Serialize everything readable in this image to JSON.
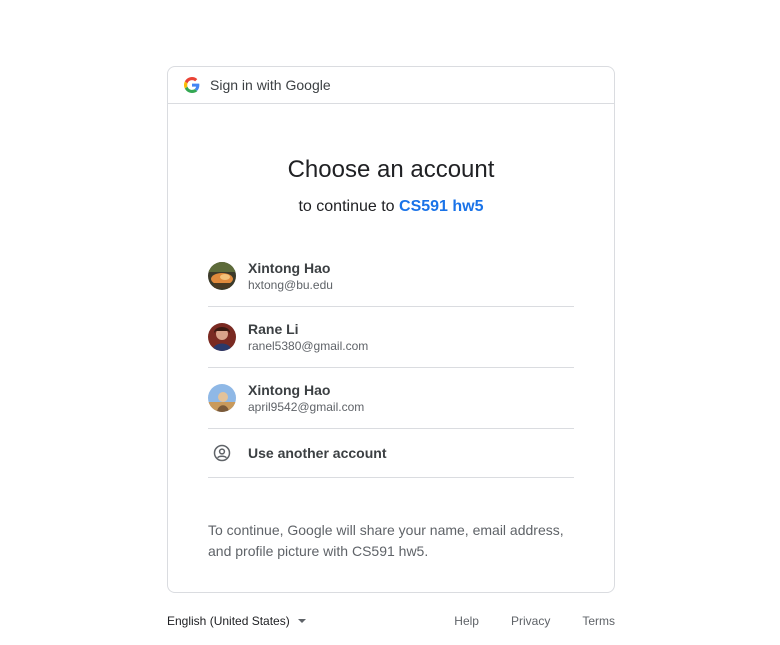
{
  "header": {
    "title": "Sign in with Google"
  },
  "main": {
    "heading": "Choose an account",
    "subheading_prefix": "to continue to",
    "app_name": "CS591 hw5"
  },
  "accounts": [
    {
      "name": "Xintong Hao",
      "email": "hxtong@bu.edu"
    },
    {
      "name": "Rane Li",
      "email": "ranel5380@gmail.com"
    },
    {
      "name": "Xintong Hao",
      "email": "april9542@gmail.com"
    }
  ],
  "other_account": {
    "label": "Use another account",
    "icon": "account-circle-icon"
  },
  "notice": {
    "line1": "To continue, Google will share your name, email address,",
    "line2": "and profile picture with CS591 hw5."
  },
  "footer": {
    "language": "English (United States)",
    "help": "Help",
    "privacy": "Privacy",
    "terms": "Terms"
  },
  "colors": {
    "accent": "#1a73e8",
    "border": "#dadce0",
    "text": "#202124",
    "muted": "#5f6368"
  }
}
